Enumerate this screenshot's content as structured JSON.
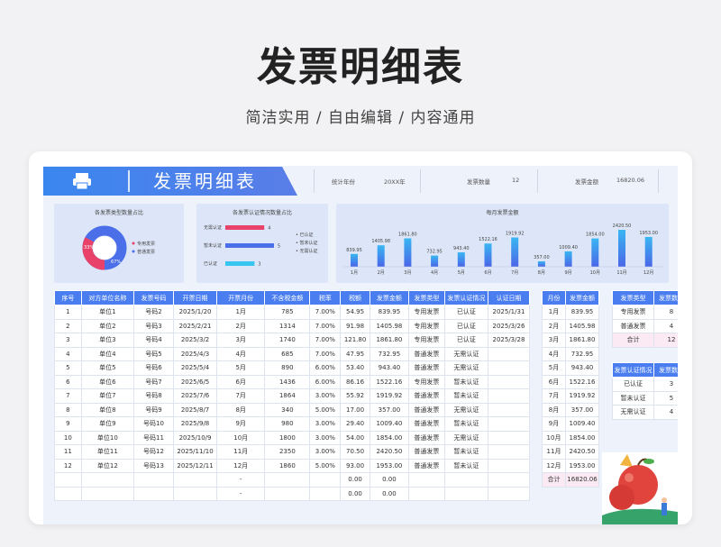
{
  "page": {
    "title": "发票明细表",
    "subtitle": "简洁实用 / 自由编辑 / 内容通用"
  },
  "header": {
    "banner_title": "发票明细表",
    "stats": [
      {
        "label": "统计年份",
        "value": "20XX年"
      },
      {
        "label": "发票数量",
        "value": "12"
      },
      {
        "label": "发票金额",
        "value": "16820.06"
      }
    ]
  },
  "donut": {
    "title": "各发票类型数量占比",
    "pct_red": "33%",
    "pct_blue": "67%",
    "legend": [
      "专用发票",
      "普通发票"
    ],
    "values": [
      33,
      67
    ],
    "colors": [
      "#e8416a",
      "#4a6fe8"
    ]
  },
  "status_chart": {
    "title": "各发票认证情况数量占比",
    "categories": [
      "无需认证",
      "暂未认证",
      "已认证"
    ],
    "values": [
      4,
      5,
      3
    ],
    "colors": [
      "#e8416a",
      "#4a6fe8",
      "#38c5f0"
    ],
    "legend": [
      "已认证",
      "暂未认证",
      "无需认证"
    ]
  },
  "chart_data": {
    "type": "bar",
    "title": "每月发票金额",
    "categories": [
      "1月",
      "2月",
      "3月",
      "4月",
      "5月",
      "6月",
      "7月",
      "8月",
      "9月",
      "10月",
      "11月",
      "12月"
    ],
    "values": [
      839.95,
      1405.98,
      1861.8,
      732.95,
      943.4,
      1522.16,
      1919.92,
      357.0,
      1009.4,
      1854.0,
      2420.5,
      1953.0
    ],
    "labels": [
      "839.95",
      "1405.98",
      "1861.80",
      "732.95",
      "943.40",
      "1522.16",
      "1919.92",
      "357.00",
      "1009.40",
      "1854.00",
      "2420.50",
      "1953.00"
    ],
    "ylim": [
      0,
      2600
    ]
  },
  "main_table": {
    "headers": [
      "序号",
      "对方单位名称",
      "发票号码",
      "开票日期",
      "开票月份",
      "不含税金额",
      "税率",
      "税额",
      "发票金额",
      "发票类型",
      "发票认证情况",
      "认证日期"
    ],
    "rows": [
      [
        "1",
        "单位1",
        "号码2",
        "2025/1/20",
        "1月",
        "785",
        "7.00%",
        "54.95",
        "839.95",
        "专用发票",
        "已认证",
        "2025/1/31"
      ],
      [
        "2",
        "单位2",
        "号码3",
        "2025/2/21",
        "2月",
        "1314",
        "7.00%",
        "91.98",
        "1405.98",
        "专用发票",
        "已认证",
        "2025/3/26"
      ],
      [
        "3",
        "单位3",
        "号码4",
        "2025/3/2",
        "3月",
        "1740",
        "7.00%",
        "121.80",
        "1861.80",
        "专用发票",
        "已认证",
        "2025/3/28"
      ],
      [
        "4",
        "单位4",
        "号码5",
        "2025/4/3",
        "4月",
        "685",
        "7.00%",
        "47.95",
        "732.95",
        "普通发票",
        "无需认证",
        ""
      ],
      [
        "5",
        "单位5",
        "号码6",
        "2025/5/4",
        "5月",
        "890",
        "6.00%",
        "53.40",
        "943.40",
        "普通发票",
        "无需认证",
        ""
      ],
      [
        "6",
        "单位6",
        "号码7",
        "2025/6/5",
        "6月",
        "1436",
        "6.00%",
        "86.16",
        "1522.16",
        "专用发票",
        "暂未认证",
        ""
      ],
      [
        "7",
        "单位7",
        "号码8",
        "2025/7/6",
        "7月",
        "1864",
        "3.00%",
        "55.92",
        "1919.92",
        "普通发票",
        "暂未认证",
        ""
      ],
      [
        "8",
        "单位8",
        "号码9",
        "2025/8/7",
        "8月",
        "340",
        "5.00%",
        "17.00",
        "357.00",
        "普通发票",
        "无需认证",
        ""
      ],
      [
        "9",
        "单位9",
        "号码10",
        "2025/9/8",
        "9月",
        "980",
        "3.00%",
        "29.40",
        "1009.40",
        "普通发票",
        "暂未认证",
        ""
      ],
      [
        "10",
        "单位10",
        "号码11",
        "2025/10/9",
        "10月",
        "1800",
        "3.00%",
        "54.00",
        "1854.00",
        "普通发票",
        "无需认证",
        ""
      ],
      [
        "11",
        "单位11",
        "号码12",
        "2025/11/10",
        "11月",
        "2350",
        "3.00%",
        "70.50",
        "2420.50",
        "普通发票",
        "暂未认证",
        ""
      ],
      [
        "12",
        "单位12",
        "号码13",
        "2025/12/11",
        "12月",
        "1860",
        "5.00%",
        "93.00",
        "1953.00",
        "普通发票",
        "暂未认证",
        ""
      ],
      [
        "",
        "",
        "",
        "",
        "-",
        "",
        "",
        "0.00",
        "0.00",
        "",
        "",
        ""
      ],
      [
        "",
        "",
        "",
        "",
        "-",
        "",
        "",
        "0.00",
        "0.00",
        "",
        "",
        ""
      ]
    ]
  },
  "month_table": {
    "headers": [
      "月份",
      "发票金额"
    ],
    "rows": [
      [
        "1月",
        "839.95"
      ],
      [
        "2月",
        "1405.98"
      ],
      [
        "3月",
        "1861.80"
      ],
      [
        "4月",
        "732.95"
      ],
      [
        "5月",
        "943.40"
      ],
      [
        "6月",
        "1522.16"
      ],
      [
        "7月",
        "1919.92"
      ],
      [
        "8月",
        "357.00"
      ],
      [
        "9月",
        "1009.40"
      ],
      [
        "10月",
        "1854.00"
      ],
      [
        "11月",
        "2420.50"
      ],
      [
        "12月",
        "1953.00"
      ]
    ],
    "total": [
      "合计",
      "16820.06"
    ]
  },
  "type_table": {
    "headers": [
      "发票类型",
      "发票数量"
    ],
    "rows": [
      [
        "专用发票",
        "8"
      ],
      [
        "普通发票",
        "4"
      ]
    ],
    "total": [
      "合计",
      "12"
    ]
  },
  "cert_table": {
    "headers": [
      "发票认证情况",
      "发票数量"
    ],
    "rows": [
      [
        "已认证",
        "3"
      ],
      [
        "暂未认证",
        "5"
      ],
      [
        "无需认证",
        "4"
      ]
    ]
  }
}
